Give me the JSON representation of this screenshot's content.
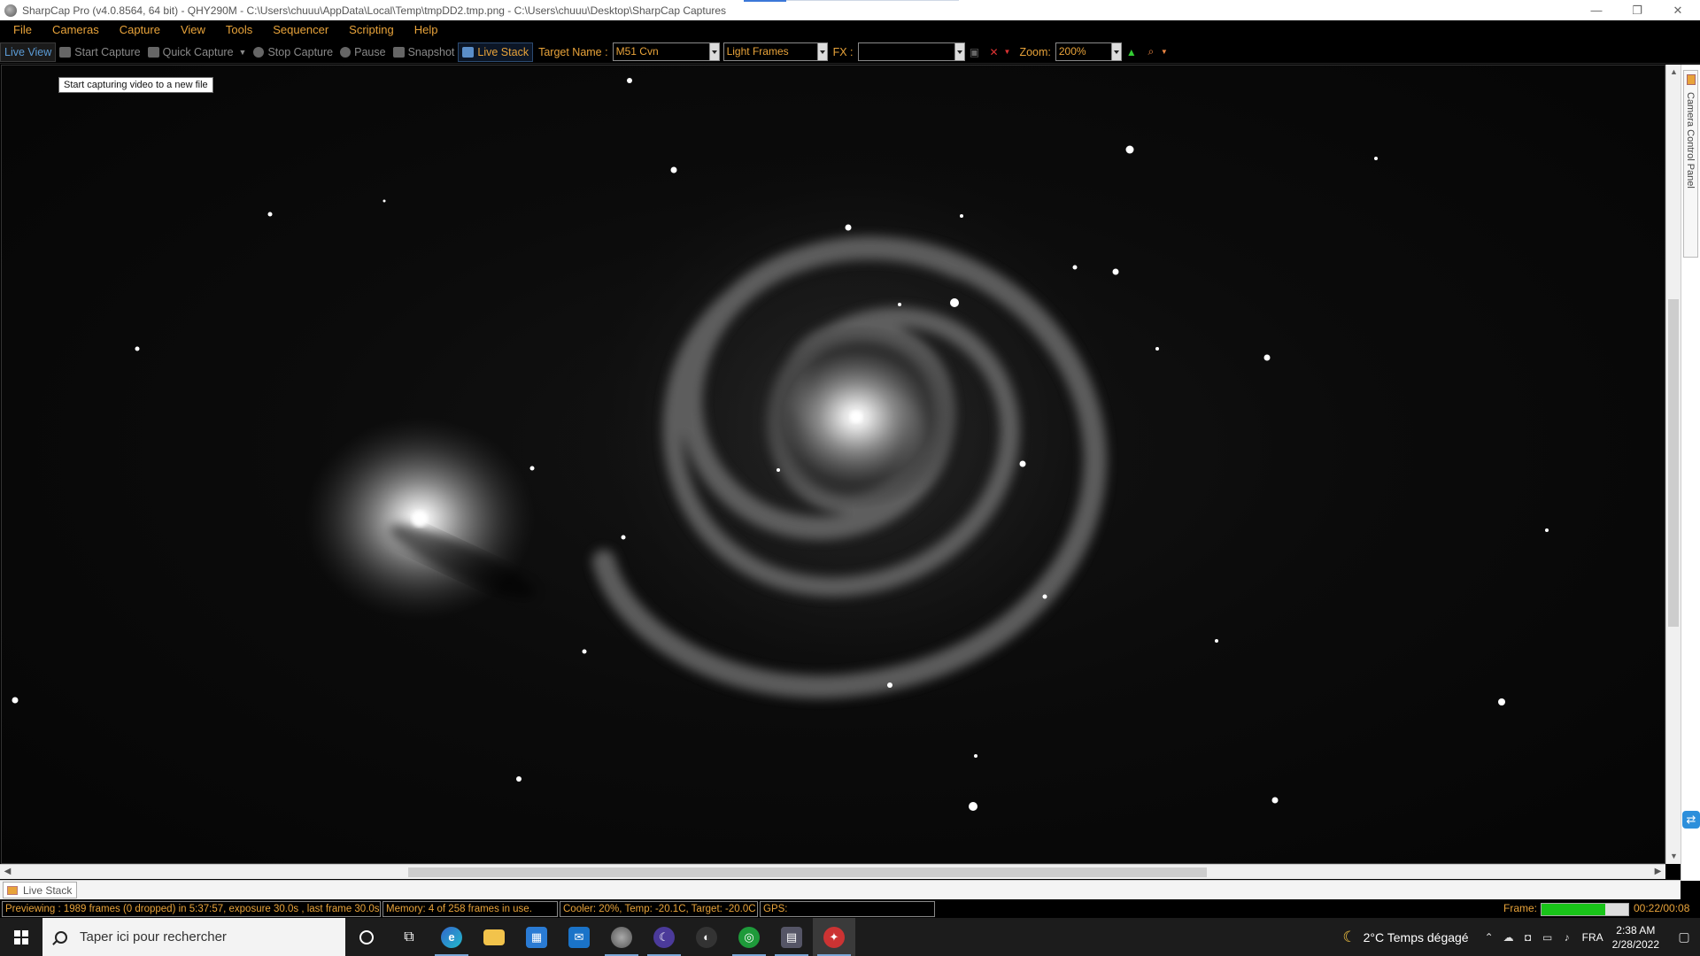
{
  "window": {
    "title": "SharpCap Pro (v4.0.8564, 64 bit) - QHY290M - C:\\Users\\chuuu\\AppData\\Local\\Temp\\tmpDD2.tmp.png - C:\\Users\\chuuu\\Desktop\\SharpCap Captures",
    "minimize": "—",
    "restore": "❐",
    "close": "✕"
  },
  "menu": {
    "items": [
      "File",
      "Cameras",
      "Capture",
      "View",
      "Tools",
      "Sequencer",
      "Scripting",
      "Help"
    ]
  },
  "toolbar": {
    "live_view": "Live View",
    "start_capture": "Start Capture",
    "quick_capture": "Quick Capture",
    "stop_capture": "Stop Capture",
    "pause": "Pause",
    "snapshot": "Snapshot",
    "live_stack": "Live Stack",
    "target_label": "Target Name :",
    "target_value": "M51 Cvn",
    "frame_type": "Light Frames",
    "fx_label": "FX :",
    "fx_value": "",
    "zoom_label": "Zoom:",
    "zoom_value": "200%"
  },
  "tooltip": "Start capturing video to a new file",
  "side_panel": {
    "label": "Camera Control Panel"
  },
  "document_tab": "Live Stack",
  "status": {
    "preview": "Previewing : 1989 frames (0 dropped) in 5:37:57, exposure 30.0s , last frame 30.0s",
    "memory": "Memory: 4 of 258 frames in use.",
    "cooler": "Cooler: 20%, Temp: -20.1C, Target: -20.0C",
    "gps": "GPS:",
    "frame_label": "Frame:",
    "frame_progress": 0.73,
    "frame_time": "00:22/00:08"
  },
  "taskbar": {
    "search_placeholder": "Taper ici pour rechercher",
    "weather": "2°C  Temps dégagé",
    "language": "FRA",
    "time": "2:38 AM",
    "date": "2/28/2022"
  },
  "colors": {
    "accent": "#e8a33a",
    "selected": "#5b9bd5",
    "progress": "#19c419"
  }
}
